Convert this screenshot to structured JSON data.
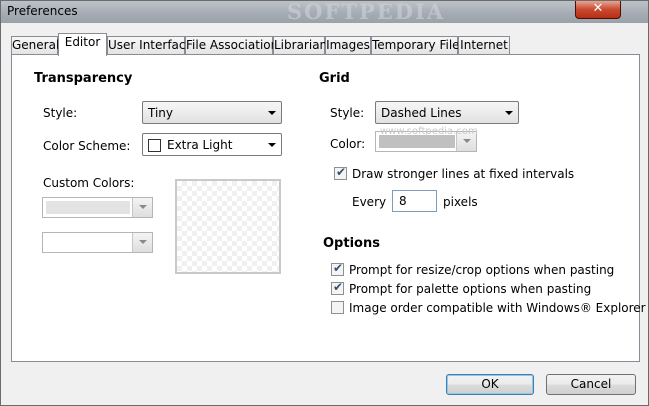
{
  "window": {
    "title": "Preferences",
    "close_label": "✕",
    "watermark": "SOFTPEDIA"
  },
  "tabs": [
    {
      "label": "General"
    },
    {
      "label": "Editor"
    },
    {
      "label": "User Interface"
    },
    {
      "label": "File Associations"
    },
    {
      "label": "Librarian"
    },
    {
      "label": "Images"
    },
    {
      "label": "Temporary Files"
    },
    {
      "label": "Internet"
    }
  ],
  "active_tab": "Editor",
  "transparency": {
    "heading": "Transparency",
    "style_label": "Style:",
    "style_value": "Tiny",
    "color_scheme_label": "Color Scheme:",
    "color_scheme_value": "Extra Light",
    "color_scheme_swatch": "#ffffff",
    "custom_colors_label": "Custom Colors:"
  },
  "grid": {
    "heading": "Grid",
    "style_label": "Style:",
    "style_value": "Dashed Lines",
    "color_label": "Color:",
    "color_value": "#c0c0c0",
    "stronger_lines_label": "Draw stronger lines at fixed intervals",
    "stronger_lines_checked": true,
    "every_label": "Every",
    "every_value": "8",
    "pixels_label": "pixels",
    "softpedia_watermark": "www.softpedia.com"
  },
  "options": {
    "heading": "Options",
    "items": [
      {
        "label": "Prompt for resize/crop options when pasting",
        "checked": true
      },
      {
        "label": "Prompt for palette options when pasting",
        "checked": true
      },
      {
        "label": "Image order compatible with Windows® Explorer",
        "checked": false
      }
    ]
  },
  "buttons": {
    "ok_label": "OK",
    "cancel_label": "Cancel"
  }
}
